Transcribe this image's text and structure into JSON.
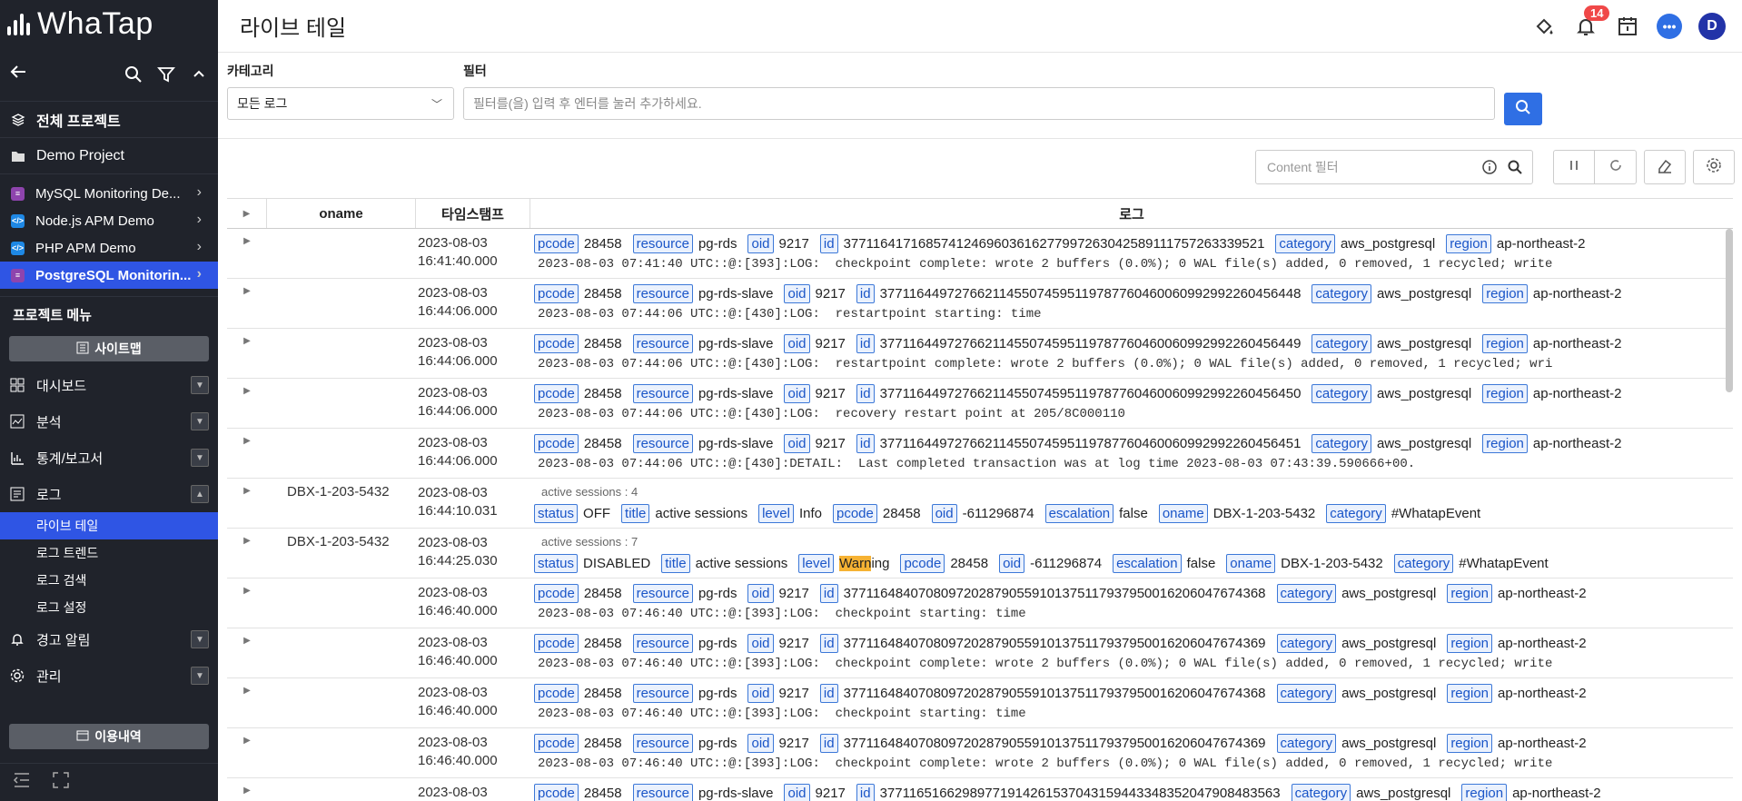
{
  "app": {
    "brand": "WhaTap",
    "page_title": "라이브 테일"
  },
  "sidebar": {
    "all_projects": "전체 프로젝트",
    "current_project": "Demo Project",
    "projects": [
      {
        "label": "MySQL Monitoring De...",
        "color": "#8e44ad",
        "active": false
      },
      {
        "label": "Node.js APM Demo",
        "color": "#1e88e5",
        "active": false
      },
      {
        "label": "PHP APM Demo",
        "color": "#1e88e5",
        "active": false
      },
      {
        "label": "PostgreSQL Monitorin...",
        "color": "#8e44ad",
        "active": true
      }
    ],
    "project_menu_label": "프로젝트 메뉴",
    "sitemap_label": "사이트맵",
    "menu": [
      {
        "label": "대시보드",
        "icon": "dashboard-icon"
      },
      {
        "label": "분석",
        "icon": "analysis-icon"
      },
      {
        "label": "통계/보고서",
        "icon": "stats-icon"
      },
      {
        "label": "로그",
        "icon": "log-icon"
      }
    ],
    "log_submenu": [
      "라이브 테일",
      "로그 트렌드",
      "로그 검색",
      "로그 설정"
    ],
    "alert_label": "경고 알림",
    "manage_label": "관리",
    "usage_label": "이용내역"
  },
  "topbar": {
    "notification_count": "14",
    "avatar_letter": "D"
  },
  "filters": {
    "category_label": "카테고리",
    "category_value": "모든 로그",
    "filter_label": "필터",
    "filter_placeholder": "필터를(을) 입력 후 엔터를 눌러 추가하세요.",
    "content_filter_placeholder": "Content 필터"
  },
  "table": {
    "headers": [
      "oname",
      "타임스탬프",
      "로그"
    ],
    "rows": [
      {
        "oname": "",
        "date": "2023-08-03",
        "time": "16:41:40.000",
        "tags": [
          [
            "pcode",
            "28458"
          ],
          [
            "resource",
            "pg-rds"
          ],
          [
            "oid",
            "9217"
          ],
          [
            "id",
            "3771164171685741246960361627799726304258911175726333952​1"
          ],
          [
            "category",
            "aws_postgresql"
          ],
          [
            "region",
            "ap-northeast-2"
          ]
        ],
        "msg": "2023-08-03 07:41:40 UTC::@:[393]:LOG:  checkpoint complete: wrote 2 buffers (0.0%); 0 WAL file(s) added, 0 removed, 1 recycled; write"
      },
      {
        "oname": "",
        "date": "2023-08-03",
        "time": "16:44:06.000",
        "tags": [
          [
            "pcode",
            "28458"
          ],
          [
            "resource",
            "pg-rds-slave"
          ],
          [
            "oid",
            "9217"
          ],
          [
            "id",
            "37711644972766211455074595119787760460060992992260456448"
          ],
          [
            "category",
            "aws_postgresql"
          ],
          [
            "region",
            "ap-northeast-2"
          ]
        ],
        "msg": "2023-08-03 07:44:06 UTC::@:[430]:LOG:  restartpoint starting: time"
      },
      {
        "oname": "",
        "date": "2023-08-03",
        "time": "16:44:06.000",
        "tags": [
          [
            "pcode",
            "28458"
          ],
          [
            "resource",
            "pg-rds-slave"
          ],
          [
            "oid",
            "9217"
          ],
          [
            "id",
            "37711644972766211455074595119787760460060992992260456449"
          ],
          [
            "category",
            "aws_postgresql"
          ],
          [
            "region",
            "ap-northeast-2"
          ]
        ],
        "msg": "2023-08-03 07:44:06 UTC::@:[430]:LOG:  restartpoint complete: wrote 2 buffers (0.0%); 0 WAL file(s) added, 0 removed, 1 recycled; wri"
      },
      {
        "oname": "",
        "date": "2023-08-03",
        "time": "16:44:06.000",
        "tags": [
          [
            "pcode",
            "28458"
          ],
          [
            "resource",
            "pg-rds-slave"
          ],
          [
            "oid",
            "9217"
          ],
          [
            "id",
            "37711644972766211455074595119787760460060992992260456450"
          ],
          [
            "category",
            "aws_postgresql"
          ],
          [
            "region",
            "ap-northeast-2"
          ]
        ],
        "msg": "2023-08-03 07:44:06 UTC::@:[430]:LOG:  recovery restart point at 205/8C000110"
      },
      {
        "oname": "",
        "date": "2023-08-03",
        "time": "16:44:06.000",
        "tags": [
          [
            "pcode",
            "28458"
          ],
          [
            "resource",
            "pg-rds-slave"
          ],
          [
            "oid",
            "9217"
          ],
          [
            "id",
            "37711644972766211455074595119787760460060992992260456451"
          ],
          [
            "category",
            "aws_postgresql"
          ],
          [
            "region",
            "ap-northeast-2"
          ]
        ],
        "msg": "2023-08-03 07:44:06 UTC::@:[430]:DETAIL:  Last completed transaction was at log time 2023-08-03 07:43:39.590666+00."
      },
      {
        "oname": "DBX-1-203-5432",
        "date": "2023-08-03",
        "time": "16:44:10.031",
        "note": "active sessions : 4",
        "tags": [
          [
            "status",
            "OFF"
          ],
          [
            "title",
            "active sessions"
          ],
          [
            "level",
            "Info"
          ],
          [
            "pcode",
            "28458"
          ],
          [
            "oid",
            "-611296874"
          ],
          [
            "escalation",
            "false"
          ],
          [
            "oname",
            "DBX-1-203-5432"
          ],
          [
            "category",
            "#WhatapEvent"
          ]
        ]
      },
      {
        "oname": "DBX-1-203-5432",
        "date": "2023-08-03",
        "time": "16:44:25.030",
        "note": "active sessions : 7",
        "tags": [
          [
            "status",
            "DISABLED"
          ],
          [
            "title",
            "active sessions"
          ],
          [
            "level",
            "Warning"
          ],
          [
            "pcode",
            "28458"
          ],
          [
            "oid",
            "-611296874"
          ],
          [
            "escalation",
            "false"
          ],
          [
            "oname",
            "DBX-1-203-5432"
          ],
          [
            "category",
            "#WhatapEvent"
          ]
        ]
      },
      {
        "oname": "",
        "date": "2023-08-03",
        "time": "16:46:40.000",
        "tags": [
          [
            "pcode",
            "28458"
          ],
          [
            "resource",
            "pg-rds"
          ],
          [
            "oid",
            "9217"
          ],
          [
            "id",
            "37711648407080972028790559101375117937950016206047674368"
          ],
          [
            "category",
            "aws_postgresql"
          ],
          [
            "region",
            "ap-northeast-2"
          ]
        ],
        "msg": "2023-08-03 07:46:40 UTC::@:[393]:LOG:  checkpoint starting: time"
      },
      {
        "oname": "",
        "date": "2023-08-03",
        "time": "16:46:40.000",
        "tags": [
          [
            "pcode",
            "28458"
          ],
          [
            "resource",
            "pg-rds"
          ],
          [
            "oid",
            "9217"
          ],
          [
            "id",
            "37711648407080972028790559101375117937950016206047674369"
          ],
          [
            "category",
            "aws_postgresql"
          ],
          [
            "region",
            "ap-northeast-2"
          ]
        ],
        "msg": "2023-08-03 07:46:40 UTC::@:[393]:LOG:  checkpoint complete: wrote 2 buffers (0.0%); 0 WAL file(s) added, 0 removed, 1 recycled; write"
      },
      {
        "oname": "",
        "date": "2023-08-03",
        "time": "16:46:40.000",
        "tags": [
          [
            "pcode",
            "28458"
          ],
          [
            "resource",
            "pg-rds"
          ],
          [
            "oid",
            "9217"
          ],
          [
            "id",
            "37711648407080972028790559101375117937950016206047674368"
          ],
          [
            "category",
            "aws_postgresql"
          ],
          [
            "region",
            "ap-northeast-2"
          ]
        ],
        "msg": "2023-08-03 07:46:40 UTC::@:[393]:LOG:  checkpoint starting: time"
      },
      {
        "oname": "",
        "date": "2023-08-03",
        "time": "16:46:40.000",
        "tags": [
          [
            "pcode",
            "28458"
          ],
          [
            "resource",
            "pg-rds"
          ],
          [
            "oid",
            "9217"
          ],
          [
            "id",
            "37711648407080972028790559101375117937950016206047674369"
          ],
          [
            "category",
            "aws_postgresql"
          ],
          [
            "region",
            "ap-northeast-2"
          ]
        ],
        "msg": "2023-08-03 07:46:40 UTC::@:[393]:LOG:  checkpoint complete: wrote 2 buffers (0.0%); 0 WAL file(s) added, 0 removed, 1 recycled; write"
      },
      {
        "oname": "",
        "date": "2023-08-03",
        "time": "",
        "tags": [
          [
            "pcode",
            "28458"
          ],
          [
            "resource",
            "pg-rds-slave"
          ],
          [
            "oid",
            "9217"
          ],
          [
            "id",
            "37711651662989771914261537043159443348352047908483563"
          ],
          [
            "category",
            "aws_postgresql"
          ],
          [
            "region",
            "ap-northeast-2"
          ]
        ],
        "msg": ""
      }
    ]
  }
}
